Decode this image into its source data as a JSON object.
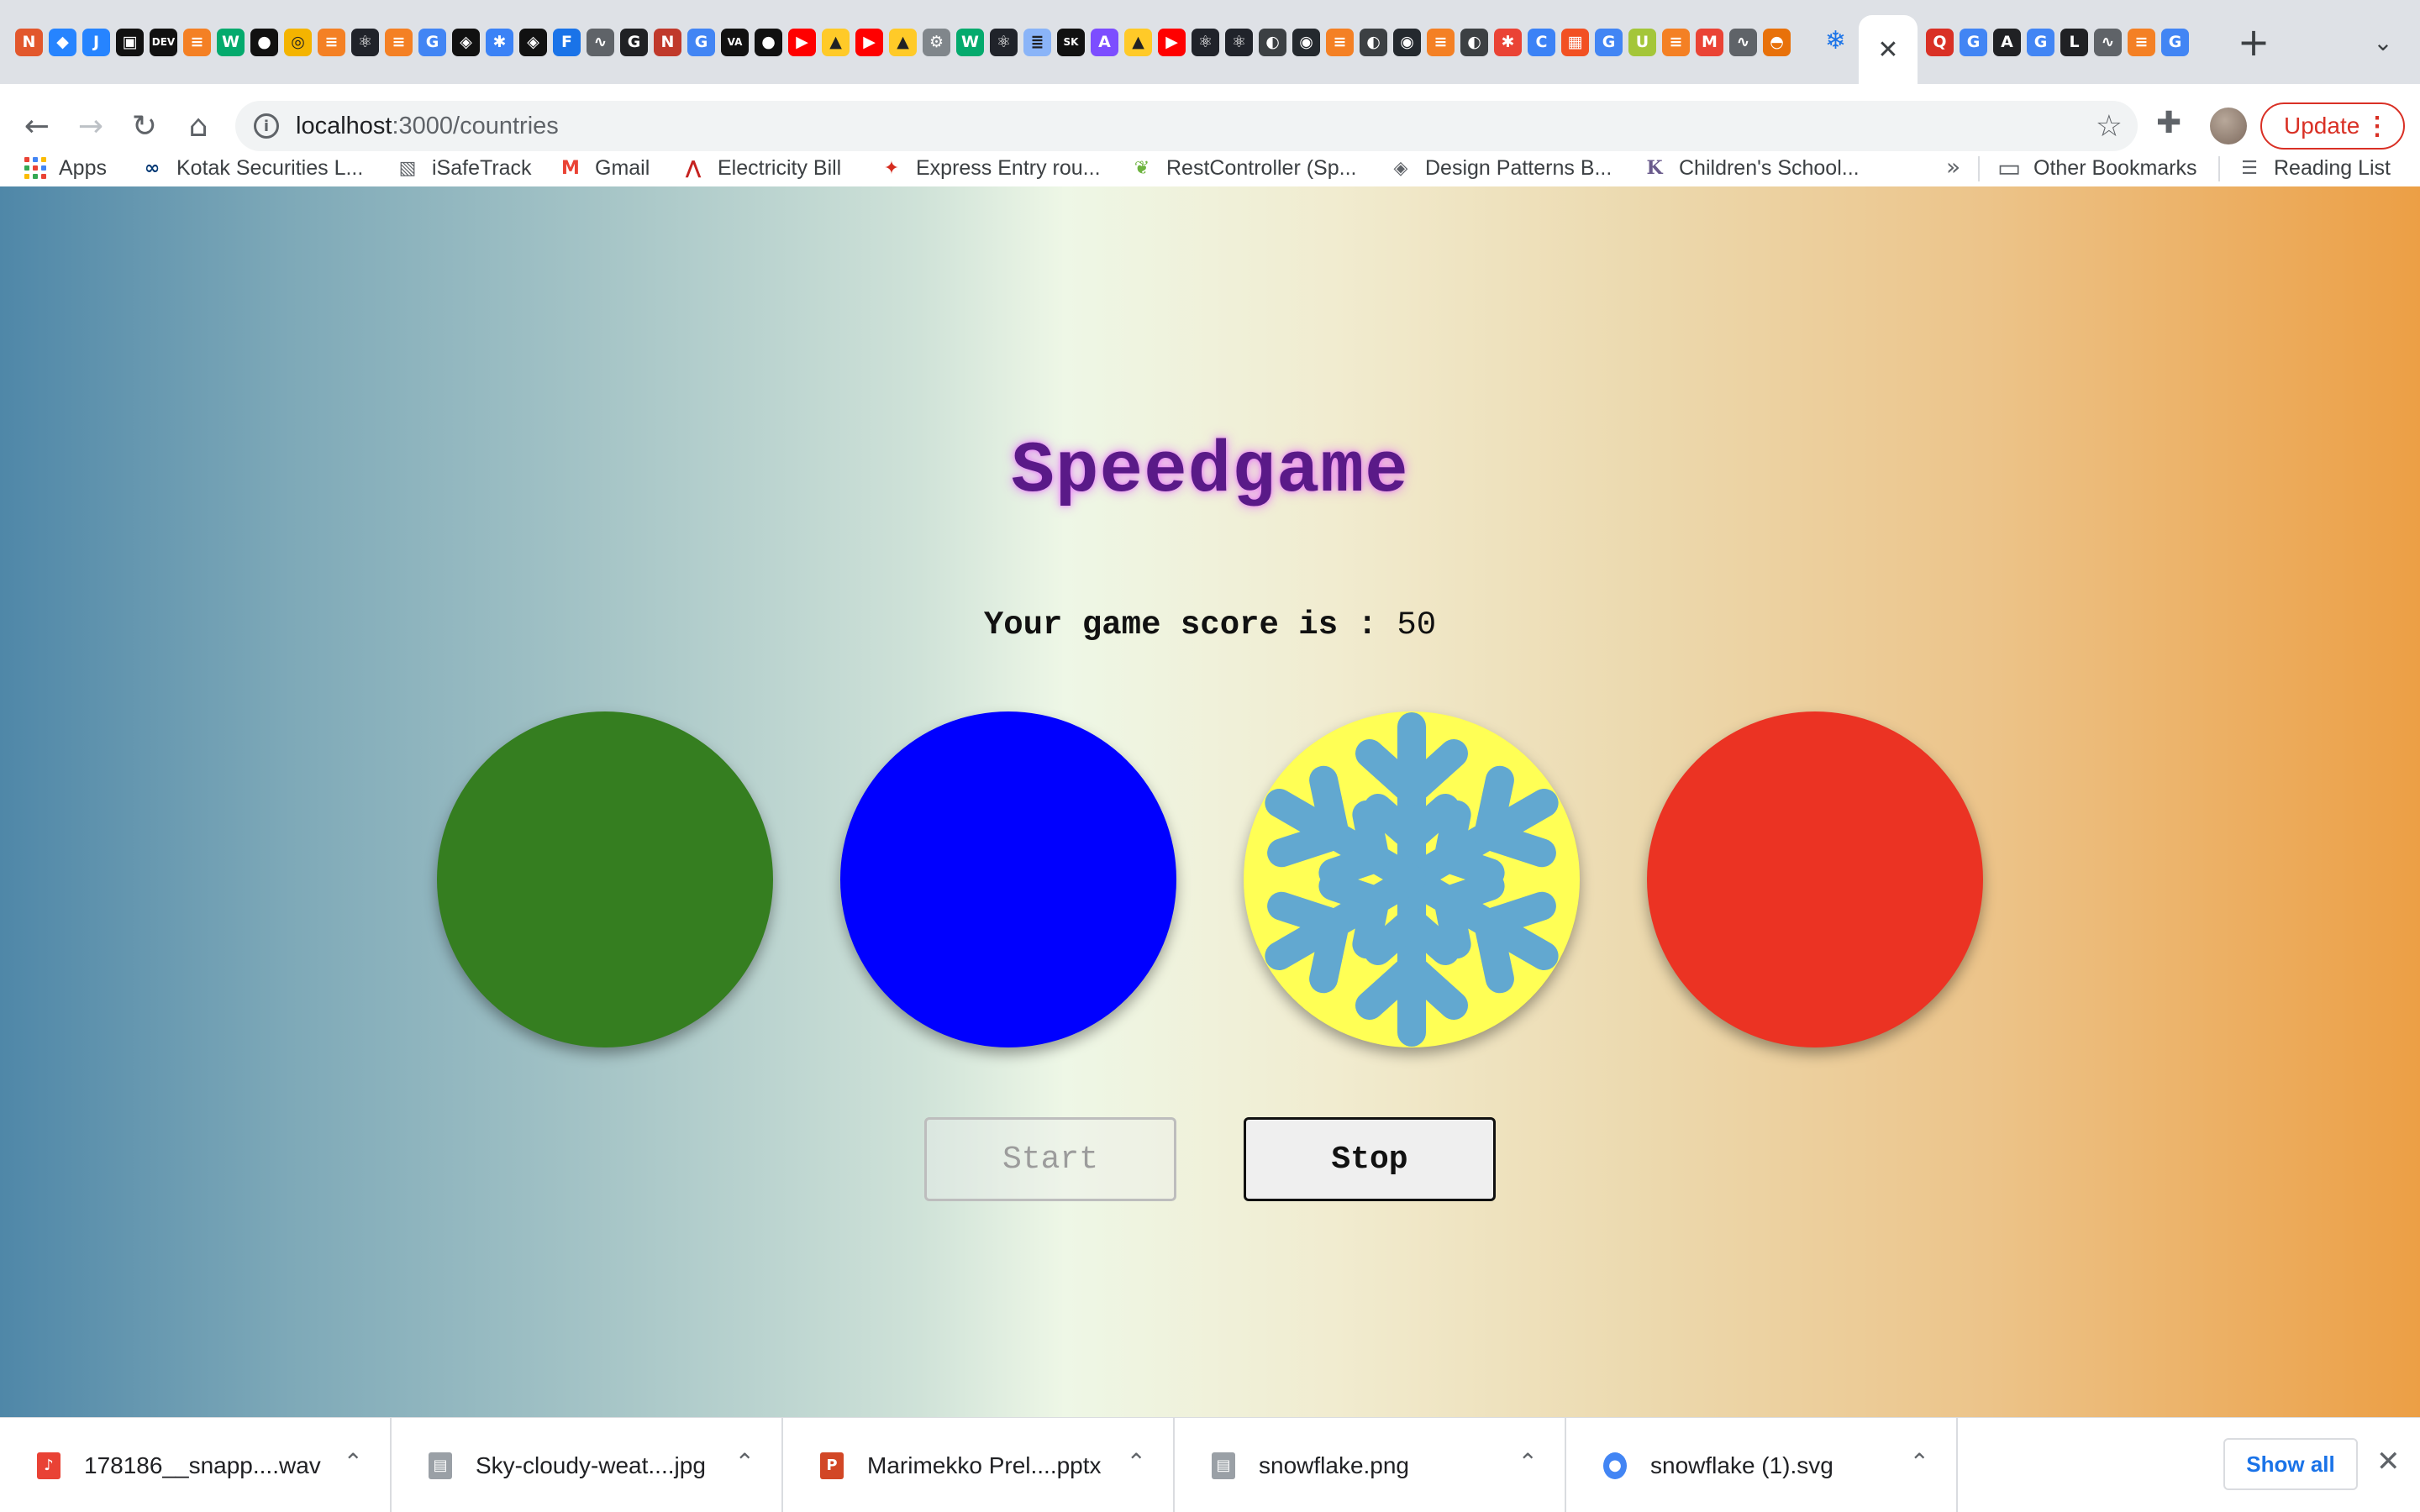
{
  "browser": {
    "tabs": {
      "favicons": [
        {
          "icon": "sketch-icon",
          "glyph": "N",
          "color": "#e2572c"
        },
        {
          "icon": "jira-diamond-icon",
          "glyph": "◆",
          "color": "#2684ff"
        },
        {
          "icon": "jira-icon",
          "glyph": "J",
          "color": "#2684ff"
        },
        {
          "icon": "grid-icon",
          "glyph": "▣",
          "color": "#111111"
        },
        {
          "icon": "dev-icon",
          "glyph": "DEV",
          "color": "#111111"
        },
        {
          "icon": "stackoverflow-icon",
          "glyph": "≡",
          "color": "#f48024"
        },
        {
          "icon": "w3schools-icon",
          "glyph": "W",
          "color": "#04aa6d"
        },
        {
          "icon": "medium-icon",
          "glyph": "●",
          "color": "#111111"
        },
        {
          "icon": "badge-icon",
          "glyph": "◎",
          "color": "#f4b400"
        },
        {
          "icon": "stackoverflow-icon",
          "glyph": "≡",
          "color": "#f48024"
        },
        {
          "icon": "react-icon",
          "glyph": "⚛",
          "color": "#20232a"
        },
        {
          "icon": "stackoverflow-icon",
          "glyph": "≡",
          "color": "#f48024"
        },
        {
          "icon": "google-icon",
          "glyph": "G",
          "color": "#4285f4"
        },
        {
          "icon": "codepen-icon",
          "glyph": "◈",
          "color": "#111111"
        },
        {
          "icon": "colorful-icon",
          "glyph": "✱",
          "color": "#3b82f6"
        },
        {
          "icon": "codepen-icon",
          "glyph": "◈",
          "color": "#111111"
        },
        {
          "icon": "f-icon",
          "glyph": "F",
          "color": "#1a73e8"
        },
        {
          "icon": "waveform-icon",
          "glyph": "∿",
          "color": "#5f6368"
        },
        {
          "icon": "circle-g-icon",
          "glyph": "G",
          "color": "#202124"
        },
        {
          "icon": "n-icon",
          "glyph": "N",
          "color": "#c0392b"
        },
        {
          "icon": "google-icon",
          "glyph": "G",
          "color": "#4285f4"
        },
        {
          "icon": "va-icon",
          "glyph": "VA",
          "color": "#111111"
        },
        {
          "icon": "medium-icon",
          "glyph": "●",
          "color": "#111111"
        },
        {
          "icon": "youtube-icon",
          "glyph": "▶",
          "color": "#ff0000"
        },
        {
          "icon": "firebase-icon",
          "glyph": "▲",
          "color": "#ffca28"
        },
        {
          "icon": "youtube-icon",
          "glyph": "▶",
          "color": "#ff0000"
        },
        {
          "icon": "firebase-icon",
          "glyph": "▲",
          "color": "#ffca28"
        },
        {
          "icon": "gear-icon",
          "glyph": "⚙",
          "color": "#80868b"
        },
        {
          "icon": "w3schools-icon",
          "glyph": "W",
          "color": "#04aa6d"
        },
        {
          "icon": "react-icon",
          "glyph": "⚛",
          "color": "#20232a"
        },
        {
          "icon": "doc-icon",
          "glyph": "≣",
          "color": "#8ab4f8"
        },
        {
          "icon": "sk-icon",
          "glyph": "SK",
          "color": "#111111"
        },
        {
          "icon": "rocket-icon",
          "glyph": "A",
          "color": "#7c4dff"
        },
        {
          "icon": "firebase-icon",
          "glyph": "▲",
          "color": "#ffca28"
        },
        {
          "icon": "youtube-icon",
          "glyph": "▶",
          "color": "#ff0000"
        },
        {
          "icon": "react-icon",
          "glyph": "⚛",
          "color": "#20232a"
        },
        {
          "icon": "react-icon",
          "glyph": "⚛",
          "color": "#20232a"
        },
        {
          "icon": "globe-icon",
          "glyph": "◐",
          "color": "#3c4043"
        },
        {
          "icon": "github-icon",
          "glyph": "◉",
          "color": "#24292e"
        },
        {
          "icon": "stackoverflow-icon",
          "glyph": "≡",
          "color": "#f48024"
        },
        {
          "icon": "globe-icon",
          "glyph": "◐",
          "color": "#3c4043"
        },
        {
          "icon": "github-icon",
          "glyph": "◉",
          "color": "#24292e"
        },
        {
          "icon": "stackoverflow-icon",
          "glyph": "≡",
          "color": "#f48024"
        },
        {
          "icon": "globe-icon",
          "glyph": "◐",
          "color": "#3c4043"
        },
        {
          "icon": "colorful-icon",
          "glyph": "✱",
          "color": "#ea4335"
        },
        {
          "icon": "c-icon",
          "glyph": "C",
          "color": "#3b82f6"
        },
        {
          "icon": "microsoft-icon",
          "glyph": "▦",
          "color": "#f25022"
        },
        {
          "icon": "google-icon",
          "glyph": "G",
          "color": "#4285f4"
        },
        {
          "icon": "u-icon",
          "glyph": "U",
          "color": "#a4c639"
        },
        {
          "icon": "stackoverflow-icon",
          "glyph": "≡",
          "color": "#f48024"
        },
        {
          "icon": "gmail-icon",
          "glyph": "M",
          "color": "#ea4335"
        },
        {
          "icon": "waveform-icon",
          "glyph": "∿",
          "color": "#5f6368"
        },
        {
          "icon": "hat-icon",
          "glyph": "◓",
          "color": "#e8710a"
        }
      ],
      "active_favicon": {
        "icon": "snowflake-icon",
        "glyph": "❄",
        "color": "#1a73e8"
      },
      "after_active_favicons": [
        {
          "icon": "q-icon",
          "glyph": "Q",
          "color": "#d93025"
        },
        {
          "icon": "google-icon",
          "glyph": "G",
          "color": "#4285f4"
        },
        {
          "icon": "a-icon",
          "glyph": "A",
          "color": "#202124"
        },
        {
          "icon": "google-icon",
          "glyph": "G",
          "color": "#4285f4"
        },
        {
          "icon": "l-icon",
          "glyph": "L",
          "color": "#202124"
        },
        {
          "icon": "waveform-icon",
          "glyph": "∿",
          "color": "#5f6368"
        },
        {
          "icon": "stackoverflow-icon",
          "glyph": "≡",
          "color": "#f48024"
        },
        {
          "icon": "google-icon",
          "glyph": "G",
          "color": "#4285f4"
        }
      ],
      "close_glyph": "✕",
      "new_tab_glyph": "+",
      "tab_search_glyph": "⌄"
    },
    "toolbar": {
      "back_glyph": "←",
      "forward_glyph": "→",
      "reload_glyph": "↻",
      "home_glyph": "⌂",
      "url_host": "localhost",
      "url_path": ":3000/countries",
      "info_glyph": "i",
      "star_glyph": "☆",
      "extensions_glyph": "✚",
      "update_label": "Update",
      "menu_glyph": "⋮"
    },
    "bookmarks": [
      {
        "label": "Apps",
        "icon": "apps-grid-icon"
      },
      {
        "label": "Kotak Securities L...",
        "icon": "kotak-icon",
        "glyph": "∞",
        "color": "#003874"
      },
      {
        "label": "iSafeTrack",
        "icon": "isafetrack-icon",
        "glyph": "▧",
        "color": "#5f6368"
      },
      {
        "label": "Gmail",
        "icon": "gmail-icon",
        "glyph": "M",
        "color": "#ea4335"
      },
      {
        "label": "Electricity Bill",
        "icon": "electricity-icon",
        "glyph": "⋀",
        "color": "#c5221f"
      },
      {
        "label": "Express Entry rou...",
        "icon": "maple-leaf-icon",
        "glyph": "✦",
        "color": "#d52b1e"
      },
      {
        "label": "RestController (Sp...",
        "icon": "spring-icon",
        "glyph": "❦",
        "color": "#6db33f"
      },
      {
        "label": "Design Patterns B...",
        "icon": "diamond-icon",
        "glyph": "◈",
        "color": "#5f6368"
      },
      {
        "label": "Children's School...",
        "icon": "k-icon",
        "glyph": "K",
        "color": "#6a5b8c"
      }
    ],
    "bookmarks_overflow_glyph": "»",
    "other_bookmarks": {
      "label": "Other Bookmarks",
      "icon": "folder-icon",
      "glyph": "▭"
    },
    "reading_list": {
      "label": "Reading List",
      "icon": "reading-list-icon",
      "glyph": "☰"
    }
  },
  "game": {
    "title": "Speedgame",
    "score_label": "Your game score is :",
    "score_value": "50",
    "circles": [
      {
        "color": "#357e20",
        "active": false
      },
      {
        "color": "#0000ff",
        "active": false
      },
      {
        "color": "#ffff55",
        "active": true,
        "icon": "snowflake-icon",
        "icon_color": "#62a8d0"
      },
      {
        "color": "#eb3323",
        "active": false
      }
    ],
    "start_label": "Start",
    "stop_label": "Stop",
    "start_disabled": true
  },
  "downloads": {
    "items": [
      {
        "name": "178186__snapp....wav",
        "icon": "audio-file-icon",
        "color": "#e94235"
      },
      {
        "name": "Sky-cloudy-weat....jpg",
        "icon": "image-file-icon",
        "color": "#9aa0a6"
      },
      {
        "name": "Marimekko Prel....pptx",
        "icon": "pptx-file-icon",
        "color": "#d24726"
      },
      {
        "name": "snowflake.png",
        "icon": "image-file-icon",
        "color": "#9aa0a6"
      },
      {
        "name": "snowflake (1).svg",
        "icon": "chrome-file-icon",
        "color": "#4285f4"
      }
    ],
    "chevron_glyph": "⌃",
    "show_all_label": "Show all",
    "close_glyph": "✕"
  }
}
